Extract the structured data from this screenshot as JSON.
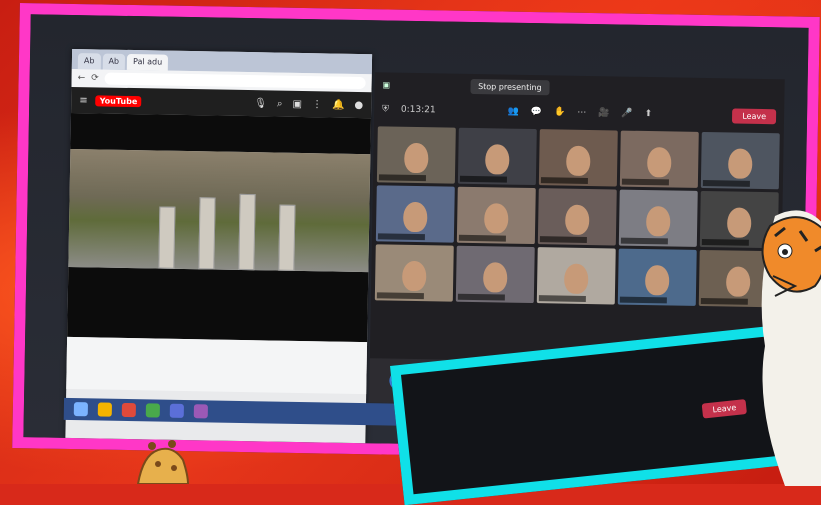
{
  "browser": {
    "tabs": [
      "Ab",
      "Ab",
      "Pal adu"
    ],
    "url": "",
    "youtube_logo": "YouTube",
    "icons": [
      "mic-icon",
      "search-icon",
      "add-video-icon",
      "apps-icon",
      "bell-icon",
      "avatar-icon"
    ]
  },
  "meeting": {
    "status_text": "Stop presenting",
    "timer": "0:13:21",
    "leave_label": "Leave",
    "participant_tiles": 15
  },
  "cyan_overlay": {
    "leave_label": "Leave"
  },
  "colors": {
    "background": "#d8291a",
    "pink_frame": "#ff37c7",
    "cyan_frame": "#10e0e8",
    "leave_button": "#c4314b",
    "youtube_red": "#ff0000"
  }
}
